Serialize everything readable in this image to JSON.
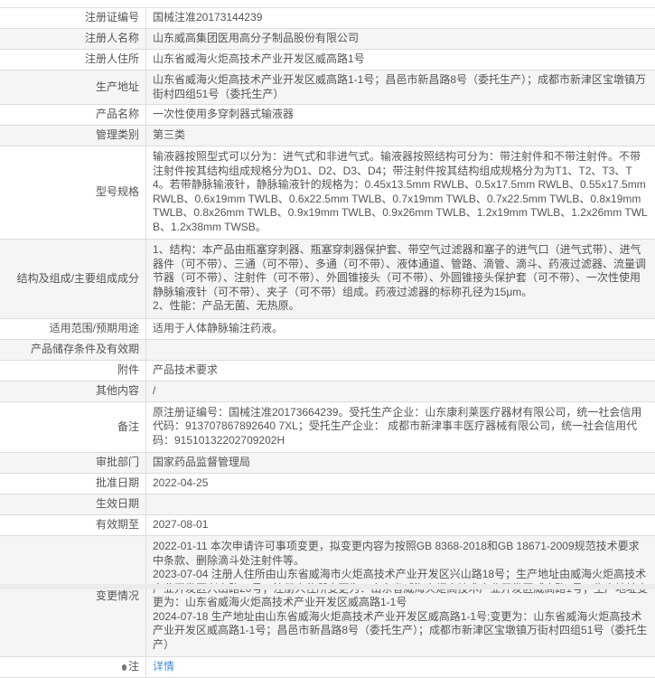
{
  "rows": [
    {
      "label": "注册证编号",
      "value": "国械注准20173144239"
    },
    {
      "label": "注册人名称",
      "value": "山东威高集团医用高分子制品股份有限公司"
    },
    {
      "label": "注册人住所",
      "value": "山东省威海火炬高技术产业开发区威高路1号"
    },
    {
      "label": "生产地址",
      "value": "山东省威海火炬高技术产业开发区威高路1-1号；昌邑市新昌路8号（委托生产）；成都市新津区宝墩镇万街村四组51号（委托生产）"
    },
    {
      "label": "产品名称",
      "value": "一次性使用多穿刺器式输液器"
    },
    {
      "label": "管理类别",
      "value": "第三类"
    },
    {
      "label": "型号规格",
      "value": "输液器按照型式可以分为：进气式和非进气式。输液器按照结构可分为：带注射件和不带注射件。不带注射件按其结构组成规格分为D1、D2、D3、D4；带注射件按其结构组成规格分为为T1、T2、T3、T4。若带静脉输液针，静脉输液针的规格为：0.45x13.5mm RWLB、0.5x17.5mm RWLB、0.55x17.5mm RWLB、0.6x19mm TWLB、0.6x22.5mm TWLB、0.7x19mm TWLB、0.7x22.5mm TWLB、0.8x19mm TWLB、0.8x26mm TWLB、0.9x19mm TWLB、0.9x26mm TWLB、1.2x19mm TWLB、1.2x26mm TWLB、1.2x38mm TWSB。"
    },
    {
      "label": "结构及组成/主要组成成分",
      "value": "1、结构：本产品由瓶塞穿刺器、瓶塞穿刺器保护套、带空气过滤器和塞子的进气口（进气式带）、进气器件（可不带）、三通（可不带）、多通（可不带）、液体通道、管路、滴管、滴斗、药液过滤器、流量调节器（可不带）、注射件（可不带）、外圆锥接头（可不带）、外圆锥接头保护套（可不带）、一次性使用静脉输液针（可不带）、夹子（可不带）组成。药液过滤器的标称孔径为15μm。",
      "value2": "2、性能：产品无菌、无热原。"
    },
    {
      "label": "适用范围/预期用途",
      "value": "适用于人体静脉输注药液。"
    },
    {
      "label": "产品储存条件及有效期",
      "value": ""
    },
    {
      "label": "附件",
      "value": "产品技术要求"
    },
    {
      "label": "其他内容",
      "value": "/"
    },
    {
      "label": "备注",
      "value": "原注册证编号：国械注准20173664239。受托生产企业：山东康利莱医疗器材有限公司，统一社会信用代码：913707867892640 7XL；受托生产企业： 成都市新津事丰医疗器械有限公司，统一社会信用代码：91510132202709202H"
    },
    {
      "label": "审批部门",
      "value": "国家药品监督管理局"
    },
    {
      "label": "批准日期",
      "value": "2022-04-25"
    },
    {
      "label": "生效日期",
      "value": ""
    },
    {
      "label": "有效期至",
      "value": "2027-08-01"
    },
    {
      "label": "变更情况",
      "lines": [
        "2022-01-11 本次申请许可事项变更，拟变更内容为按照GB 8368-2018和GB 18671-2009规范技术要求中条款、删除滴斗处注射件等。",
        "2023-07-04 注册人住所由山东省威海市火炬高技术产业开发区兴山路18号；生产地址由威海火炬高技术产业开发区兴山路20号；注册人住所变更为：山东省威海火炬高技术产业开发区威高路1号；生产地址变更为：山东省威海火炬高技术产业开发区威高路1-1号",
        "2024-07-18 生产地址由山东省威海火炬高技术产业开发区威高路1-1号;变更为：山东省威海火炬高技术产业开发区威高路1-1号；昌邑市新昌路8号（委托生产）；成都市新津区宝墩镇万街村四组51号（委托生产）"
      ]
    },
    {
      "label": "注",
      "value": "详情"
    }
  ],
  "colors": {
    "link": "#3b8fe0",
    "alt_row": "#f5f5f5",
    "border": "#dcdcdc"
  }
}
